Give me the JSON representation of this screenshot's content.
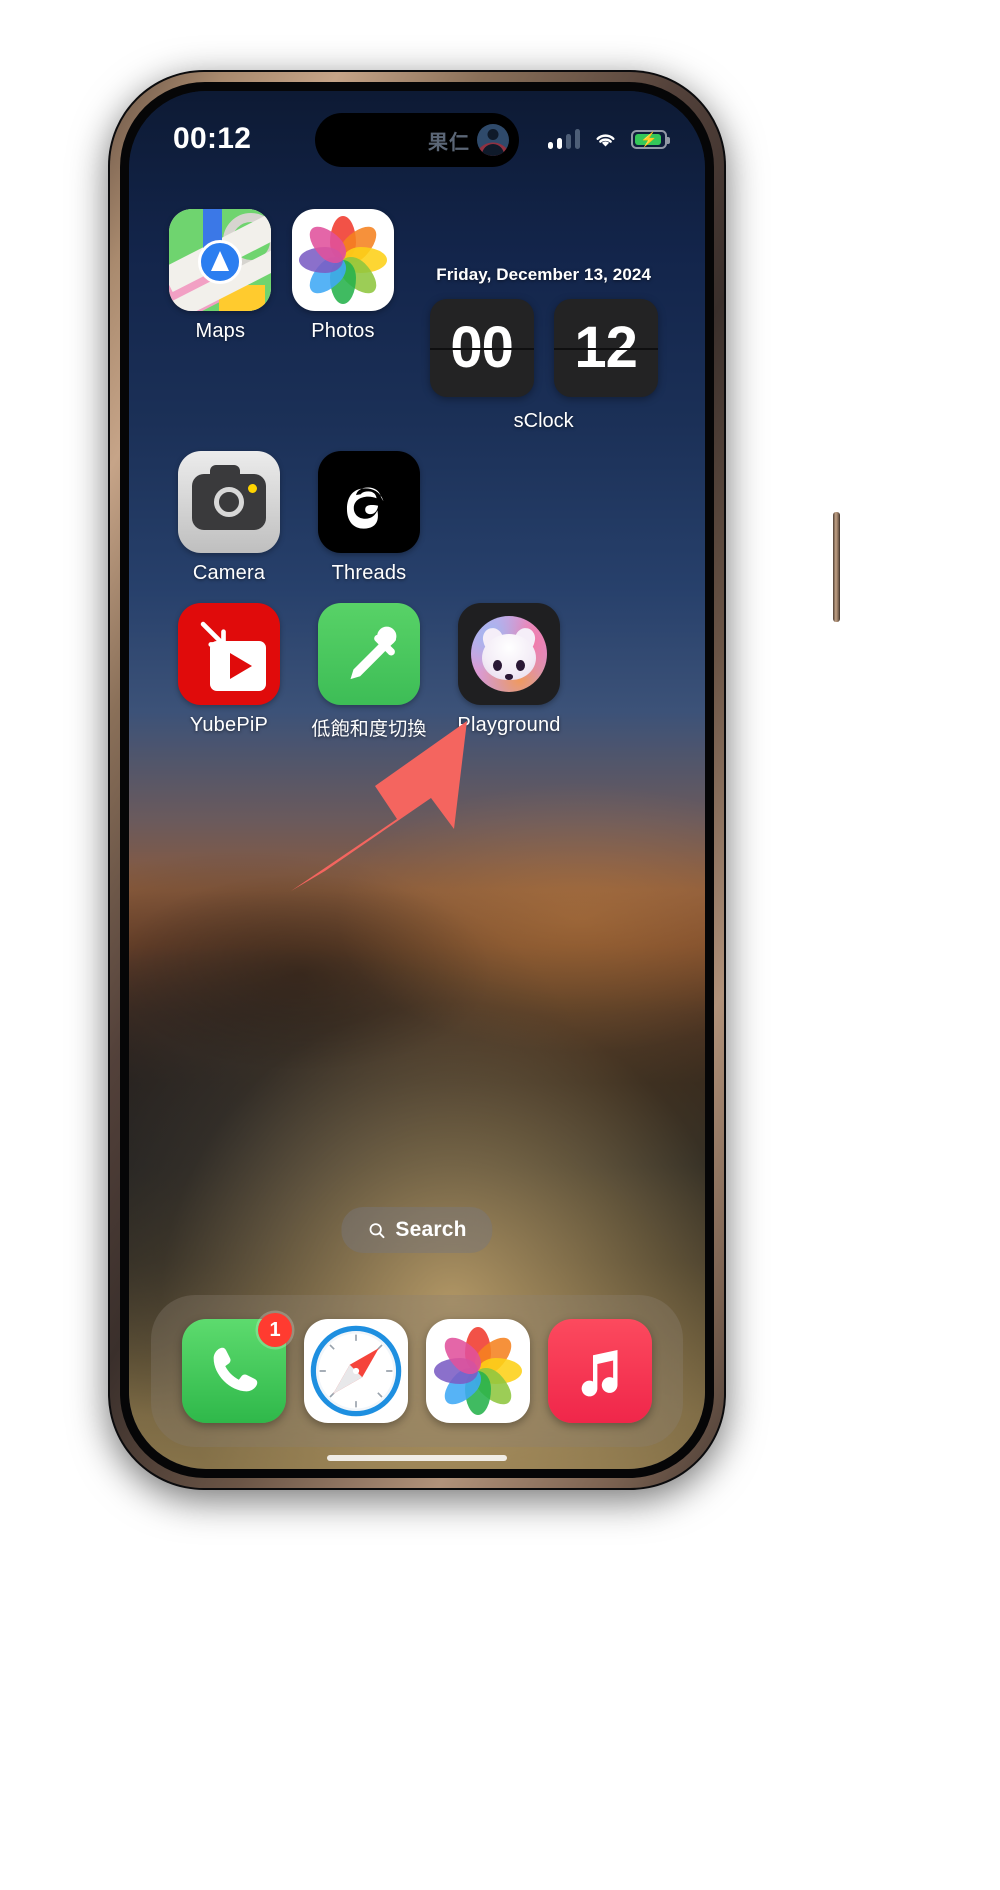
{
  "device": {
    "name": "iPhone 16 Pro",
    "frame_color": "#a98a6e"
  },
  "status_bar": {
    "time": "00:12",
    "dynamic_island": {
      "label": "果仁",
      "avatar_icon": "person-circle-icon"
    },
    "signal_icon": "cellular-signal-icon",
    "signal_bars_active": 2,
    "signal_bars_total": 4,
    "wifi_icon": "wifi-icon",
    "battery": {
      "icon": "battery-charging-icon",
      "level_percent": 92,
      "charging": true,
      "color": "#34c759"
    }
  },
  "home_screen": {
    "rows": [
      {
        "apps": [
          {
            "label": "Maps",
            "icon": "maps-icon"
          },
          {
            "label": "Photos",
            "icon": "photos-icon"
          }
        ]
      },
      {
        "apps": [
          {
            "label": "Camera",
            "icon": "camera-icon"
          },
          {
            "label": "Threads",
            "icon": "threads-icon"
          }
        ]
      },
      {
        "apps": [
          {
            "label": "YubePiP",
            "icon": "yubepip-icon"
          },
          {
            "label": "低飽和度切換",
            "icon": "eyedropper-icon"
          },
          {
            "label": "Playground",
            "icon": "playground-icon"
          }
        ]
      }
    ],
    "widget": {
      "name": "sClock",
      "date": "Friday, December 13, 2024",
      "hours": "00",
      "minutes": "12"
    },
    "annotation": {
      "type": "arrow",
      "color": "#f4655f",
      "points_to": "Playground"
    },
    "search": {
      "label": "Search",
      "icon": "search-icon"
    },
    "dock": {
      "items": [
        {
          "label": "Phone",
          "icon": "phone-icon",
          "badge": "1"
        },
        {
          "label": "Safari",
          "icon": "safari-icon",
          "badge": null
        },
        {
          "label": "Photos",
          "icon": "photos-icon",
          "badge": null
        },
        {
          "label": "Music",
          "icon": "music-icon",
          "badge": null
        }
      ]
    }
  },
  "colors": {
    "accent_red": "#ff3b30",
    "green": "#34c759",
    "arrow": "#f4655f",
    "wallpaper_top": "#0d1a33",
    "wallpaper_mid": "#8a5b3c",
    "wallpaper_bottom": "#8b784f"
  }
}
